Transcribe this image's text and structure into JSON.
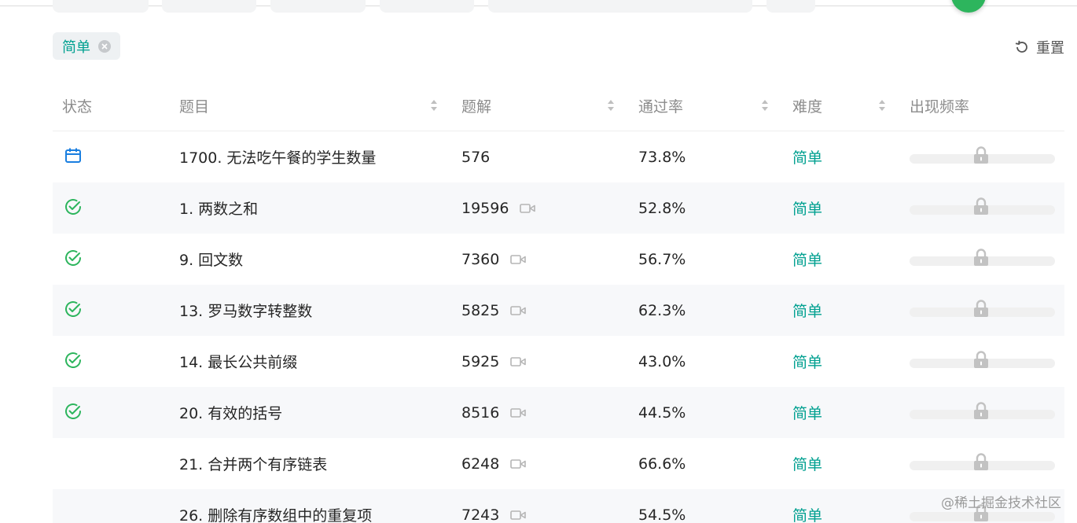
{
  "filter_tag": {
    "label": "简单"
  },
  "reset_label": "重置",
  "columns": {
    "status": "状态",
    "title": "题目",
    "solutions": "题解",
    "acceptance": "通过率",
    "difficulty": "难度",
    "frequency": "出现频率"
  },
  "rows": [
    {
      "status": "calendar-icon",
      "title": "1700. 无法吃午餐的学生数量",
      "solutions": "576",
      "has_video": false,
      "acceptance": "73.8%",
      "difficulty": "简单"
    },
    {
      "status": "check-circle-icon",
      "title": "1. 两数之和",
      "solutions": "19596",
      "has_video": true,
      "acceptance": "52.8%",
      "difficulty": "简单"
    },
    {
      "status": "check-circle-icon",
      "title": "9. 回文数",
      "solutions": "7360",
      "has_video": true,
      "acceptance": "56.7%",
      "difficulty": "简单"
    },
    {
      "status": "check-circle-icon",
      "title": "13. 罗马数字转整数",
      "solutions": "5825",
      "has_video": true,
      "acceptance": "62.3%",
      "difficulty": "简单"
    },
    {
      "status": "check-circle-icon",
      "title": "14. 最长公共前缀",
      "solutions": "5925",
      "has_video": true,
      "acceptance": "43.0%",
      "difficulty": "简单"
    },
    {
      "status": "check-circle-icon",
      "title": "20. 有效的括号",
      "solutions": "8516",
      "has_video": true,
      "acceptance": "44.5%",
      "difficulty": "简单"
    },
    {
      "status": "",
      "title": "21. 合并两个有序链表",
      "solutions": "6248",
      "has_video": true,
      "acceptance": "66.6%",
      "difficulty": "简单"
    },
    {
      "status": "",
      "title": "26. 删除有序数组中的重复项",
      "solutions": "7243",
      "has_video": true,
      "acceptance": "54.5%",
      "difficulty": "简单"
    }
  ],
  "watermark": "@稀土掘金技术社区",
  "colors": {
    "accent": "#00a090",
    "check": "#2db55d",
    "calendar": "#1a7fe0"
  }
}
